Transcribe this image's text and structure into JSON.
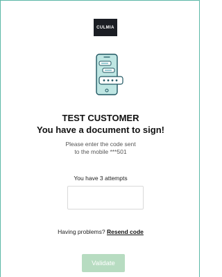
{
  "brand": {
    "logo_text": "CULMIA"
  },
  "illustration": {
    "icon": "phone-password-icon",
    "pin_mask": "****",
    "colors": {
      "phone_fill": "#bfe6e3",
      "phone_stroke": "#1f5661",
      "accent": "#4fa9b8"
    }
  },
  "signer": {
    "name": "TEST CUSTOMER",
    "headline": "You have a document to sign!",
    "instruction_line1": "Please enter the code sent",
    "instruction_line2": "to the mobile ***501"
  },
  "verification": {
    "attempts_text": "You have 3 attempts",
    "code_value": "",
    "problems_text": "Having problems?",
    "resend_label": "Resend code"
  },
  "actions": {
    "validate_label": "Validate",
    "validate_color": "#b7dcc1"
  },
  "theme": {
    "border_color": "#5bb7a6"
  }
}
